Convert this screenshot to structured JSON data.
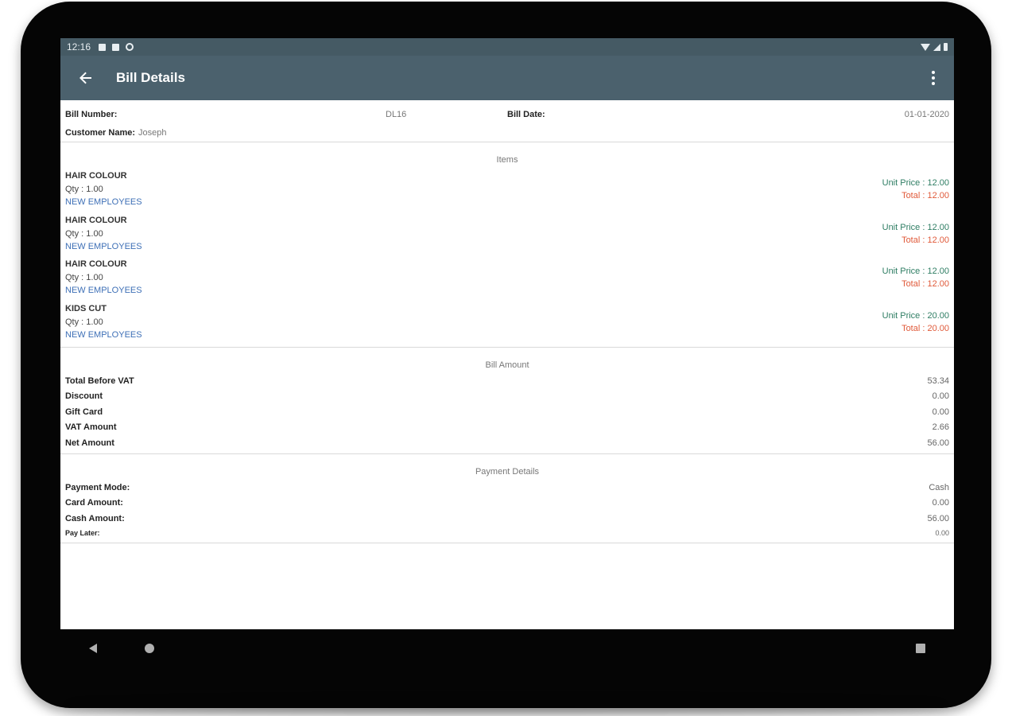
{
  "statusbar": {
    "time": "12:16"
  },
  "appbar": {
    "title": "Bill Details"
  },
  "header": {
    "bill_number_label": "Bill Number:",
    "bill_number_value": "DL16",
    "bill_date_label": "Bill Date:",
    "bill_date_value": "01-01-2020",
    "customer_label": "Customer Name:",
    "customer_value": "Joseph"
  },
  "items_section": {
    "title": "Items",
    "items": [
      {
        "name": "HAIR COLOUR",
        "qty": "Qty : 1.00",
        "employee": "NEW EMPLOYEES",
        "unit_price": "Unit Price : 12.00",
        "total": "Total : 12.00"
      },
      {
        "name": "HAIR COLOUR",
        "qty": "Qty : 1.00",
        "employee": "NEW EMPLOYEES",
        "unit_price": "Unit Price : 12.00",
        "total": "Total : 12.00"
      },
      {
        "name": "HAIR COLOUR",
        "qty": "Qty : 1.00",
        "employee": "NEW EMPLOYEES",
        "unit_price": "Unit Price : 12.00",
        "total": "Total : 12.00"
      },
      {
        "name": "KIDS CUT",
        "qty": "Qty : 1.00",
        "employee": "NEW EMPLOYEES",
        "unit_price": "Unit Price : 20.00",
        "total": "Total : 20.00"
      }
    ]
  },
  "bill_amount": {
    "title": "Bill Amount",
    "rows": [
      {
        "label": "Total Before VAT",
        "value": "53.34"
      },
      {
        "label": "Discount",
        "value": "0.00"
      },
      {
        "label": "Gift Card",
        "value": "0.00"
      },
      {
        "label": "VAT Amount",
        "value": "2.66"
      },
      {
        "label": "Net Amount",
        "value": "56.00"
      }
    ]
  },
  "payment_details": {
    "title": "Payment Details",
    "rows": [
      {
        "label": "Payment Mode:",
        "value": "Cash"
      },
      {
        "label": "Card Amount:",
        "value": "0.00"
      },
      {
        "label": "Cash Amount:",
        "value": "56.00"
      },
      {
        "label": "Pay Later:",
        "value": "0.00"
      }
    ]
  },
  "colors": {
    "appbar": "#4b616d",
    "statusbar": "#455a64",
    "employee_link": "#3d6fb6",
    "unit_price": "#2e7d63",
    "total": "#e05a3a"
  }
}
